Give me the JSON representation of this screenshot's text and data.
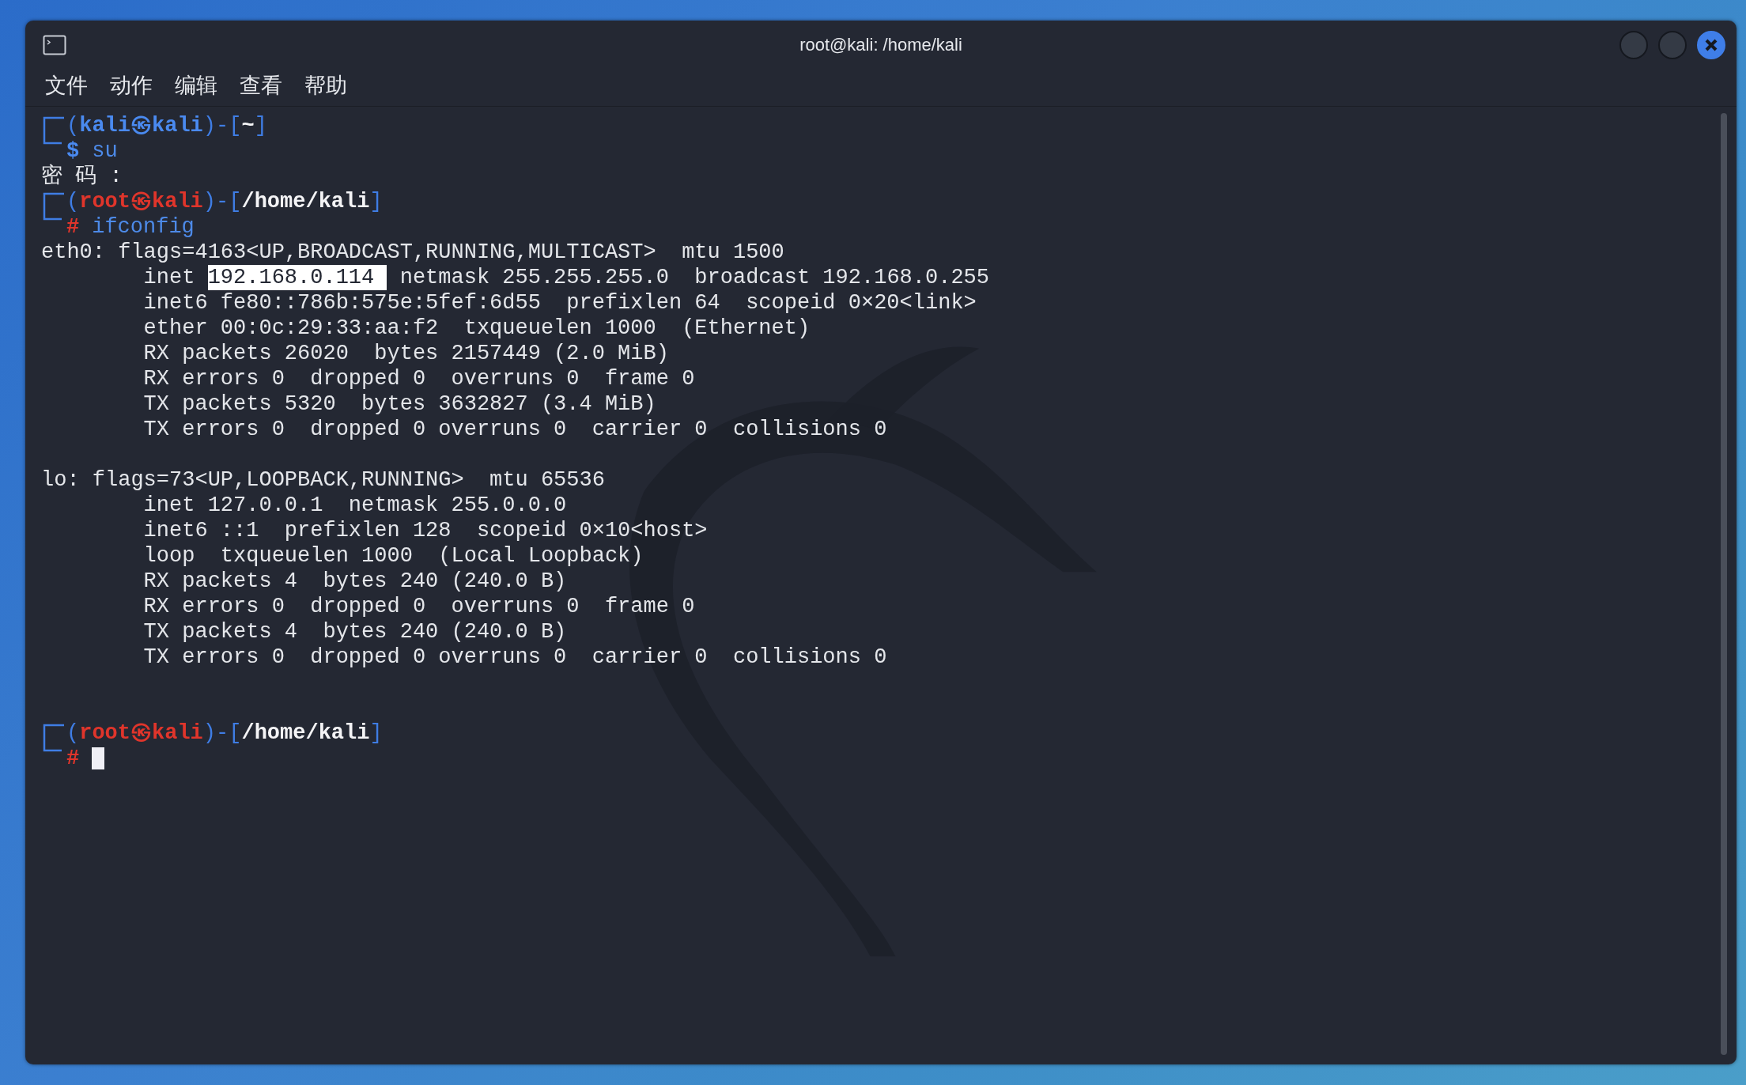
{
  "window": {
    "title": "root@kali: /home/kali"
  },
  "menu": [
    "文件",
    "动作",
    "编辑",
    "查看",
    "帮助"
  ],
  "terminal": {
    "lines": [
      {
        "kind": "prompt",
        "root": false,
        "open": "(",
        "user": "kali",
        "at": "㉿",
        "host": "kali",
        "mid": ")-[",
        "path": "~",
        "close": "]",
        "symbol": "$",
        "command": "su",
        "cursor": false
      },
      {
        "kind": "text",
        "text": "密 码 :"
      },
      {
        "kind": "prompt",
        "root": true,
        "open": "(",
        "user": "root",
        "at": "㉿",
        "host": "kali",
        "mid": ")-[",
        "path": "/home/kali",
        "close": "]",
        "symbol": "#",
        "command": "ifconfig",
        "cursor": false
      },
      {
        "kind": "text",
        "text": "eth0: flags=4163<UP,BROADCAST,RUNNING,MULTICAST>  mtu 1500"
      },
      {
        "kind": "selection",
        "before": "        inet ",
        "selected": "192.168.0.114 ",
        "after": " netmask 255.255.255.0  broadcast 192.168.0.255"
      },
      {
        "kind": "text",
        "text": "        inet6 fe80::786b:575e:5fef:6d55  prefixlen 64  scopeid 0×20<link>"
      },
      {
        "kind": "text",
        "text": "        ether 00:0c:29:33:aa:f2  txqueuelen 1000  (Ethernet)"
      },
      {
        "kind": "text",
        "text": "        RX packets 26020  bytes 2157449 (2.0 MiB)"
      },
      {
        "kind": "text",
        "text": "        RX errors 0  dropped 0  overruns 0  frame 0"
      },
      {
        "kind": "text",
        "text": "        TX packets 5320  bytes 3632827 (3.4 MiB)"
      },
      {
        "kind": "text",
        "text": "        TX errors 0  dropped 0 overruns 0  carrier 0  collisions 0"
      },
      {
        "kind": "blank"
      },
      {
        "kind": "text",
        "text": "lo: flags=73<UP,LOOPBACK,RUNNING>  mtu 65536"
      },
      {
        "kind": "text",
        "text": "        inet 127.0.0.1  netmask 255.0.0.0"
      },
      {
        "kind": "text",
        "text": "        inet6 ::1  prefixlen 128  scopeid 0×10<host>"
      },
      {
        "kind": "text",
        "text": "        loop  txqueuelen 1000  (Local Loopback)"
      },
      {
        "kind": "text",
        "text": "        RX packets 4  bytes 240 (240.0 B)"
      },
      {
        "kind": "text",
        "text": "        RX errors 0  dropped 0  overruns 0  frame 0"
      },
      {
        "kind": "text",
        "text": "        TX packets 4  bytes 240 (240.0 B)"
      },
      {
        "kind": "text",
        "text": "        TX errors 0  dropped 0 overruns 0  carrier 0  collisions 0"
      },
      {
        "kind": "blank"
      },
      {
        "kind": "blank"
      },
      {
        "kind": "prompt",
        "root": true,
        "open": "(",
        "user": "root",
        "at": "㉿",
        "host": "kali",
        "mid": ")-[",
        "path": "/home/kali",
        "close": "]",
        "symbol": "#",
        "cursor": true
      }
    ]
  }
}
